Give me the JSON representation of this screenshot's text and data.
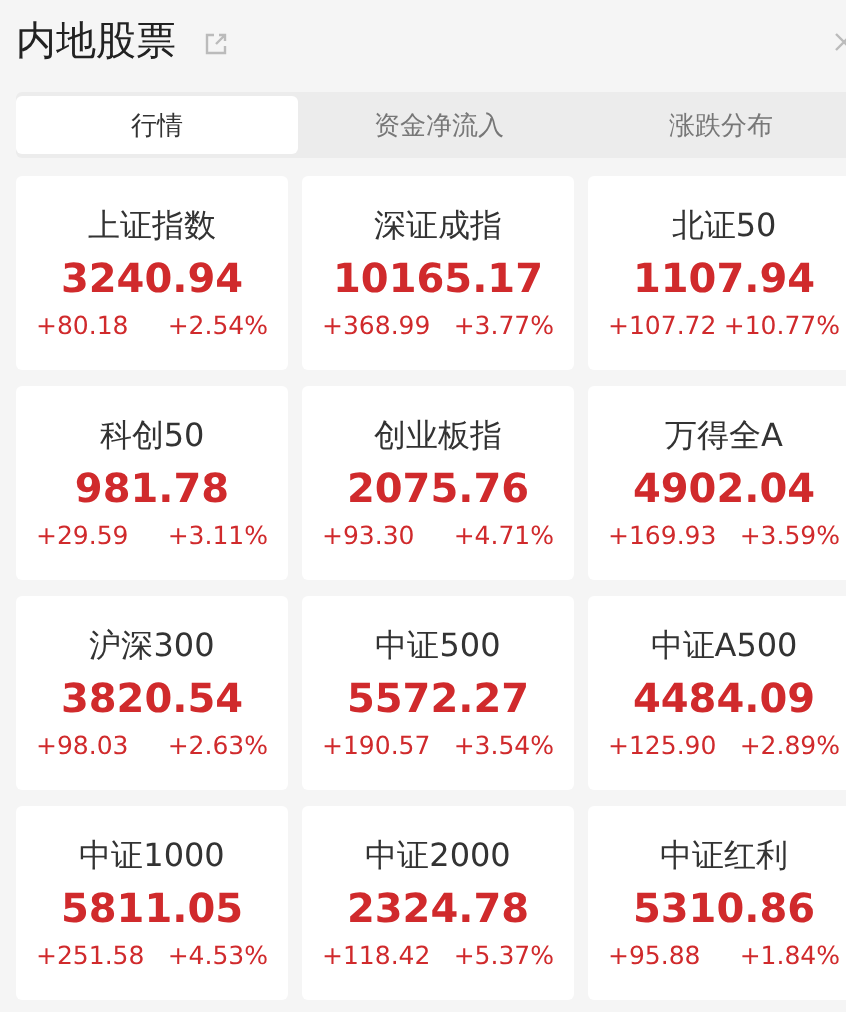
{
  "title": "内地股票",
  "tabs": [
    {
      "label": "行情",
      "selected": true
    },
    {
      "label": "资金净流入",
      "selected": false
    },
    {
      "label": "涨跌分布",
      "selected": false
    }
  ],
  "indices": [
    {
      "name": "上证指数",
      "value": "3240.94",
      "change": "+80.18",
      "change_pct": "+2.54%"
    },
    {
      "name": "深证成指",
      "value": "10165.17",
      "change": "+368.99",
      "change_pct": "+3.77%"
    },
    {
      "name": "北证50",
      "value": "1107.94",
      "change": "+107.72",
      "change_pct": "+10.77%"
    },
    {
      "name": "科创50",
      "value": "981.78",
      "change": "+29.59",
      "change_pct": "+3.11%"
    },
    {
      "name": "创业板指",
      "value": "2075.76",
      "change": "+93.30",
      "change_pct": "+4.71%"
    },
    {
      "name": "万得全A",
      "value": "4902.04",
      "change": "+169.93",
      "change_pct": "+3.59%"
    },
    {
      "name": "沪深300",
      "value": "3820.54",
      "change": "+98.03",
      "change_pct": "+2.63%"
    },
    {
      "name": "中证500",
      "value": "5572.27",
      "change": "+190.57",
      "change_pct": "+3.54%"
    },
    {
      "name": "中证A500",
      "value": "4484.09",
      "change": "+125.90",
      "change_pct": "+2.89%"
    },
    {
      "name": "中证1000",
      "value": "5811.05",
      "change": "+251.58",
      "change_pct": "+4.53%"
    },
    {
      "name": "中证2000",
      "value": "2324.78",
      "change": "+118.42",
      "change_pct": "+5.37%"
    },
    {
      "name": "中证红利",
      "value": "5310.86",
      "change": "+95.88",
      "change_pct": "+1.84%"
    }
  ]
}
